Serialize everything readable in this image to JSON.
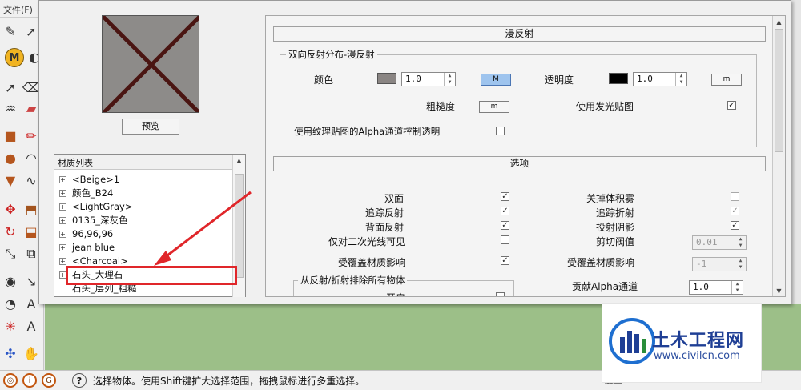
{
  "host": {
    "menu_file": "文件(F)",
    "measurement_label": "度量",
    "status_text": "选择物体。使用Shift键扩大选择范围，拖拽鼠标进行多重选择。"
  },
  "dialog": {
    "preview_button": "预览",
    "material_list": {
      "header": "材质列表",
      "items": [
        "<Beige>1",
        "颜色_B24",
        "<LightGray>",
        "0135_深灰色",
        "96,96,96",
        "jean blue",
        "<Charcoal>",
        "石头_大理石",
        "石头_层列_粗糙"
      ],
      "selected_index": 7
    },
    "diffuse": {
      "section_title": "漫反射",
      "group_title": "双向反射分布-漫反射",
      "color_label": "颜色",
      "color_value": "1.0",
      "color_swatch": "#8a8583",
      "color_map_button": "M",
      "transparency_label": "透明度",
      "transparency_value": "1.0",
      "transparency_swatch": "#000000",
      "transparency_map_button": "m",
      "roughness_label": "粗糙度",
      "roughness_map_button": "m",
      "emissive_label": "使用发光贴图",
      "emissive_checked": "✓",
      "alpha_label": "使用纹理贴图的Alpha通道控制透明",
      "alpha_checked": ""
    },
    "options": {
      "section_title": "选项",
      "double_sided": {
        "label": "双面",
        "mark": "✓"
      },
      "trace_reflections": {
        "label": "追踪反射",
        "mark": "✓"
      },
      "back_reflection": {
        "label": "背面反射",
        "mark": "✓"
      },
      "secondary_rays_only": {
        "label": "仅对二次光线可见",
        "mark": ""
      },
      "override_material": {
        "label": "受覆盖材质影响",
        "mark": "✓"
      },
      "disable_volume_fog": {
        "label": "关掉体积雾",
        "mark": ""
      },
      "trace_refractions": {
        "label": "追踪折射",
        "mark": "✓"
      },
      "cast_shadows": {
        "label": "投射阴影",
        "mark": "✓"
      },
      "cutoff": {
        "label": "剪切阀值",
        "value": "0.01"
      },
      "override_material_2": {
        "label": "受覆盖材质影响",
        "value": "-1"
      },
      "exclude_group_title": "从反射/折射排除所有物体",
      "enable_label": "开启",
      "alpha_contribution": {
        "label": "贡献Alpha通道",
        "value": "1.0"
      }
    }
  },
  "watermark": {
    "name": "土木工程网",
    "url": "www.civilcn.com"
  },
  "colors": {
    "annotation": "#e0262a",
    "viewport_green": "#9cbf88",
    "active_button": "#9ec4ee"
  }
}
